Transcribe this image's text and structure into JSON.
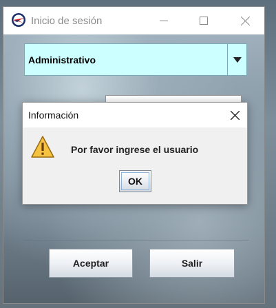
{
  "window": {
    "title": "Inicio de sesión",
    "icons": {
      "app": "airplane-logo-icon",
      "minimize": "minimize-icon",
      "maximize": "maximize-icon",
      "close": "close-icon"
    }
  },
  "login": {
    "role_select": {
      "selected": "Administrativo",
      "icon": "chevron-down-icon"
    },
    "buttons": {
      "accept": "Aceptar",
      "exit": "Salir"
    }
  },
  "dialog": {
    "title": "Información",
    "message": "Por favor ingrese el usuario",
    "ok": "OK",
    "icons": {
      "warning": "warning-icon",
      "close": "close-icon"
    }
  },
  "colors": {
    "combo_bg": "#ccffff",
    "warning_yellow": "#f5c242",
    "titlebar_text": "#8a8a8a"
  }
}
